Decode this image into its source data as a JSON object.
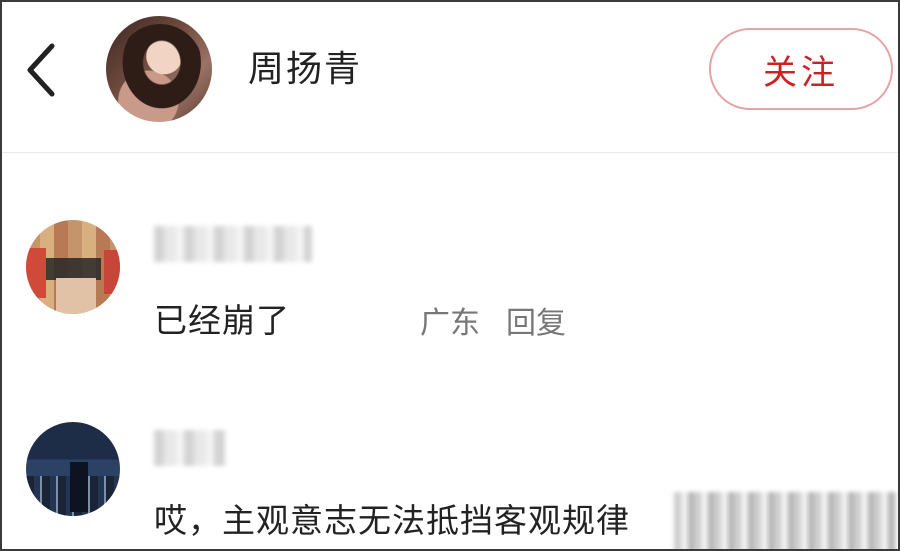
{
  "header": {
    "back_icon": "chevron-left-icon",
    "name": "周扬青",
    "follow_label": "关注"
  },
  "comments": [
    {
      "text": "已经崩了",
      "location": "广东",
      "reply_label": "回复"
    },
    {
      "text": "哎，主观意志无法抵挡客观规律"
    }
  ],
  "colors": {
    "accent": "#cc2222",
    "follow_border": "#e7a3a3",
    "text": "#222222",
    "meta": "#777777"
  }
}
